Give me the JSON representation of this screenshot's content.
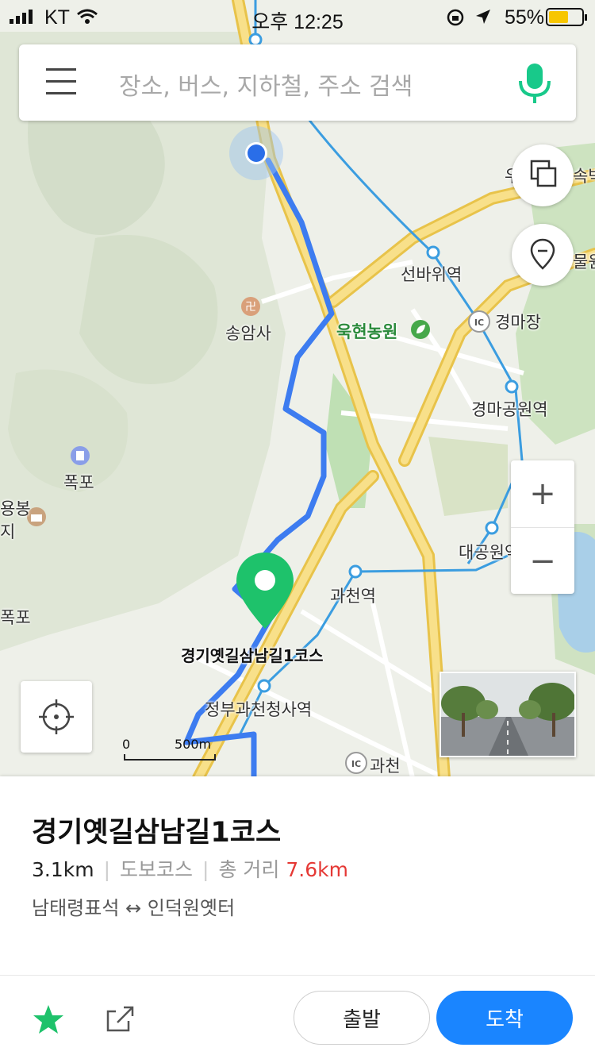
{
  "status_bar": {
    "carrier": "KT",
    "time": "오후 12:25",
    "battery_percent": "55%"
  },
  "search": {
    "placeholder": "장소, 버스, 지하철, 주소 검색"
  },
  "map": {
    "labels": {
      "station_seonbawi": "선바위역",
      "temple_songam": "송암사",
      "park_okhyeon": "욱현농원",
      "ic_gyeongmajang": "경마장",
      "station_gyeongmapark": "경마공원역",
      "waterfall": "폭포",
      "station_daegongwon": "대공원역",
      "station_gwacheon": "과천역",
      "route_name_label": "경기옛길삼남길1코스",
      "station_govcomplex": "정부과천청사역",
      "ic_gwacheon": "과천",
      "edge_yongbong": "용봉",
      "edge_ji": "지",
      "edge_pok": "폭포",
      "edge_sok": "속박",
      "edge_mul": "물원",
      "edge_u": "우"
    },
    "scale": {
      "zero": "0",
      "distance": "500m"
    },
    "colors": {
      "route": "#3d7cf0",
      "marker": "#1ec26b",
      "road_major": "#f5d25d",
      "subway": "#3b9de0"
    }
  },
  "zoom": {
    "plus": "+",
    "minus": "−"
  },
  "panel": {
    "title": "경기옛길삼남길1코스",
    "length": "3.1km",
    "category": "도보코스",
    "total_label": "총 거리",
    "total_value": "7.6km",
    "endpoints": "남태령표석 ↔ 인덕원옛터",
    "start_label": "출발",
    "end_label": "도착"
  }
}
